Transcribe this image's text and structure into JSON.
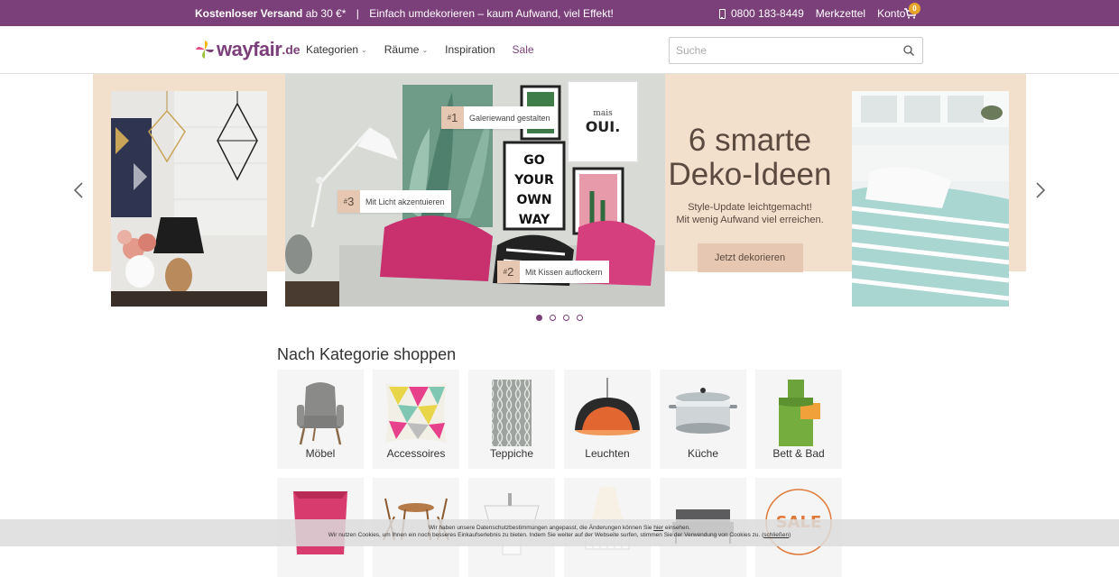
{
  "topbar": {
    "shipping_bold": "Kostenloser Versand",
    "shipping_rest": "ab 30 €*",
    "separator": "|",
    "slogan": "Einfach umdekorieren – kaum Aufwand, viel Effekt!",
    "phone": "0800 183-8449",
    "watchlist": "Merkzettel",
    "account": "Konto",
    "cart_count": "0",
    "phone_icon": "phone-icon",
    "cart_icon": "cart-icon"
  },
  "header": {
    "logo_text": "wayfair",
    "logo_tld": ".de",
    "nav": [
      {
        "label": "Kategorien",
        "has_dropdown": true
      },
      {
        "label": "Räume",
        "has_dropdown": true
      },
      {
        "label": "Inspiration",
        "has_dropdown": false
      },
      {
        "label": "Sale",
        "has_dropdown": false
      }
    ],
    "search_placeholder": "Suche",
    "search_icon": "search-icon"
  },
  "carousel": {
    "headline": "6 smarte Deko-Ideen",
    "subline_1": "Style-Update leichtgemacht!",
    "subline_2": "Mit wenig Aufwand viel erreichen.",
    "cta": "Jetzt dekorieren",
    "tags": [
      {
        "num": "1",
        "text": "Galeriewand gestalten"
      },
      {
        "num": "3",
        "text": "Mit Licht akzentuieren"
      },
      {
        "num": "2",
        "text": "Mit Kissen auflockern"
      }
    ],
    "dot_count": 4,
    "active_dot": 0
  },
  "categories": {
    "title": "Nach Kategorie shoppen",
    "items": [
      {
        "label": "Möbel",
        "icon": "armchair"
      },
      {
        "label": "Accessoires",
        "icon": "cushion"
      },
      {
        "label": "Teppiche",
        "icon": "rug"
      },
      {
        "label": "Leuchten",
        "icon": "pendant-lamp"
      },
      {
        "label": "Küche",
        "icon": "cooking-pot"
      },
      {
        "label": "Bett & Bad",
        "icon": "bedding"
      },
      {
        "label": "",
        "icon": "storage-box"
      },
      {
        "label": "",
        "icon": "garden-furniture"
      },
      {
        "label": "",
        "icon": "washbasin"
      },
      {
        "label": "",
        "icon": "baby-cot"
      },
      {
        "label": "",
        "icon": "sofa"
      },
      {
        "label": "",
        "icon": "sale-badge"
      }
    ]
  },
  "cookie": {
    "line1_a": "Wir haben unsere Datenschutzbestimmungen angepasst, die Änderungen können Sie",
    "line1_link": "hier",
    "line1_b": "einsehen.",
    "line2": "Wir nutzen Cookies, um Ihnen ein noch besseres Einkaufserlebnis zu bieten. Indem Sie weiter auf der Webseite surfen, stimmen Sie der Verwendung von Cookies zu.",
    "close": "schließen"
  },
  "colors": {
    "brand": "#7b3f79",
    "peach": "#f2dfcc",
    "badge": "#e7a52b"
  }
}
